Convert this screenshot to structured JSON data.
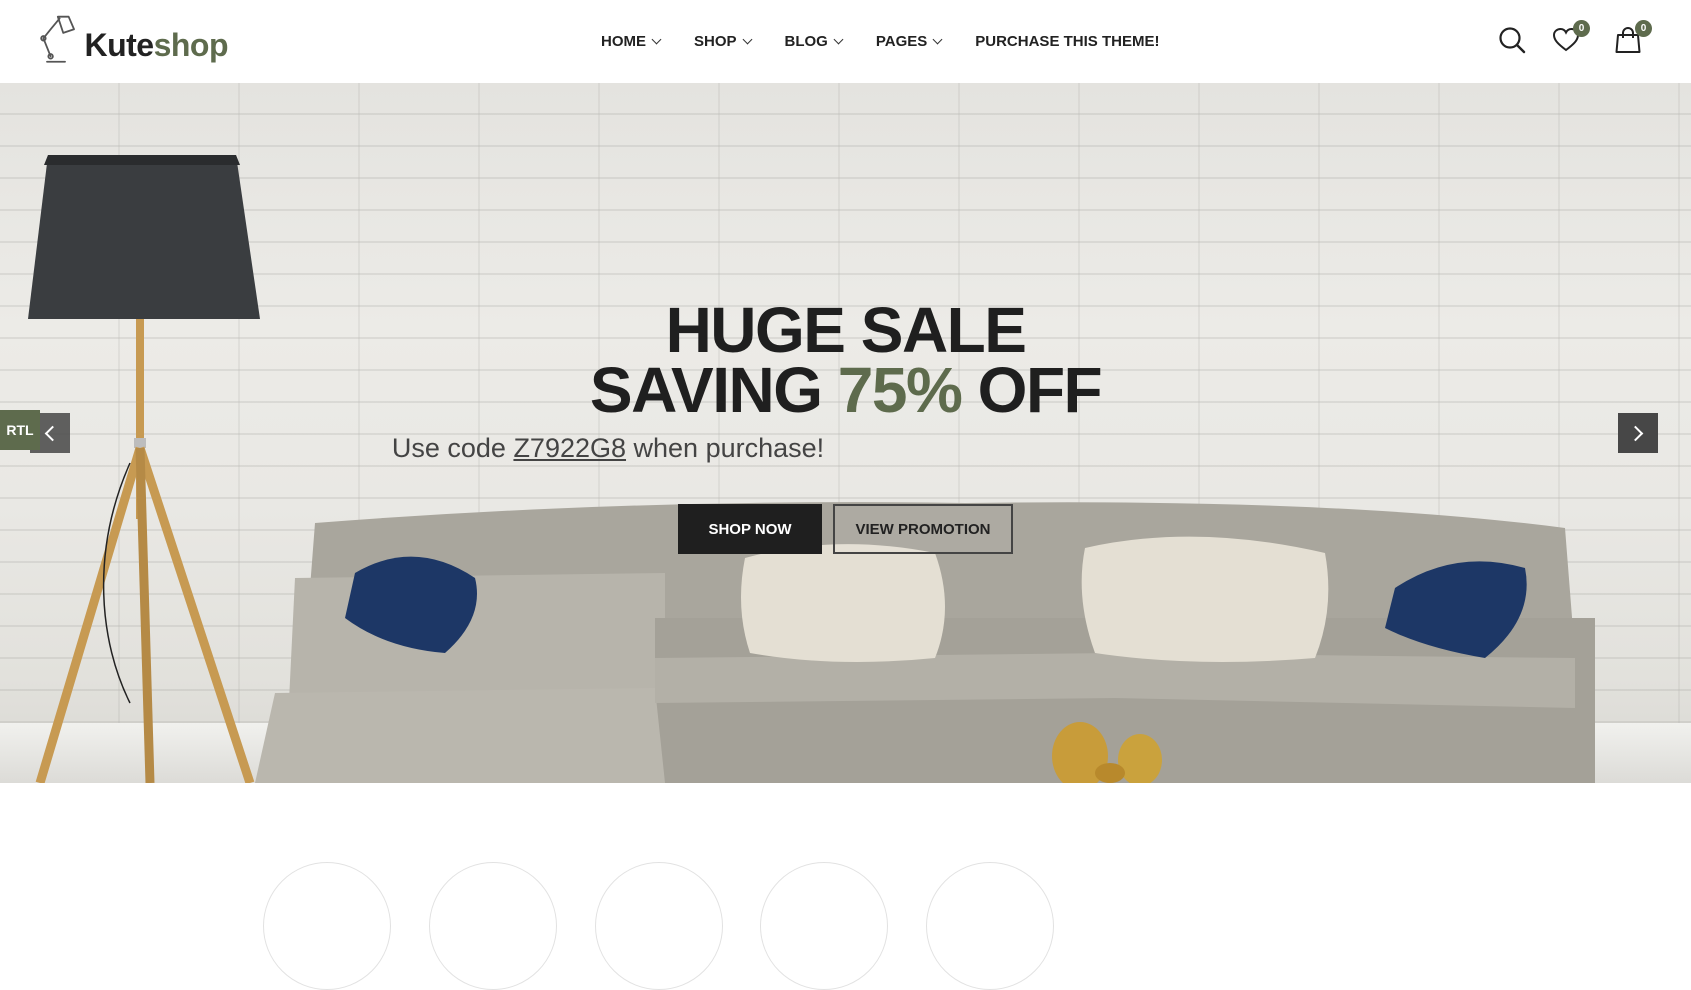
{
  "header": {
    "logo": {
      "part1": "Kute",
      "part2": "shop"
    },
    "nav": [
      {
        "label": "HOME",
        "has_dropdown": true
      },
      {
        "label": "SHOP",
        "has_dropdown": true
      },
      {
        "label": "BLOG",
        "has_dropdown": true
      },
      {
        "label": "PAGES",
        "has_dropdown": true
      },
      {
        "label": "PURCHASE THIS THEME!",
        "has_dropdown": false
      }
    ],
    "icons": {
      "search": "search-icon",
      "wishlist": "heart-icon",
      "cart": "shopping-bag-icon"
    },
    "wishlist_count": "0",
    "cart_count": "0"
  },
  "hero": {
    "title_line1": "HUGE SALE",
    "title_line2_a": "SAVING",
    "title_line2_accent": "75%",
    "title_line2_b": "OFF",
    "subtitle_a": "Use code",
    "subtitle_code": "Z7922G8",
    "subtitle_b": "when purchase!",
    "btn_shop": "SHOP NOW",
    "btn_promo": "VIEW PROMOTION",
    "rtl_label": "RTL"
  },
  "colors": {
    "accent": "#5e6b4d",
    "dark": "#1f1f1f"
  }
}
